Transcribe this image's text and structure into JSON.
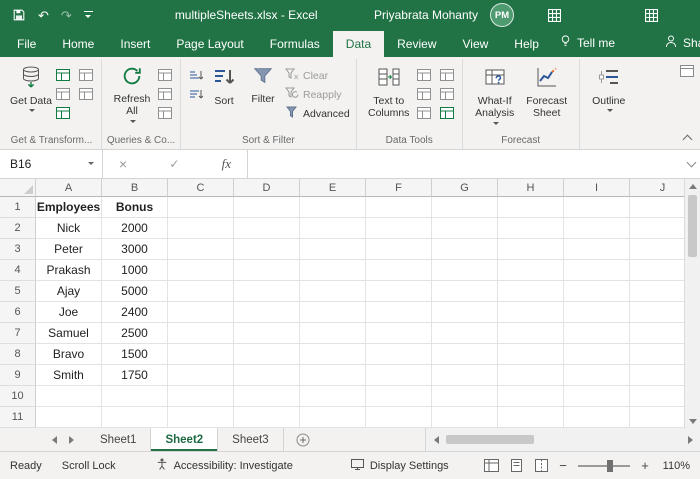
{
  "titlebar": {
    "title": "multipleSheets.xlsx - Excel",
    "user_name": "Priyabrata Mohanty",
    "avatar_initials": "PM"
  },
  "tabs": {
    "items": [
      "File",
      "Home",
      "Insert",
      "Page Layout",
      "Formulas",
      "Data",
      "Review",
      "View",
      "Help"
    ],
    "active": "Data",
    "tell_me": "Tell me",
    "share": "Share"
  },
  "ribbon": {
    "buttons": {
      "get_data": "Get Data",
      "refresh_all": "Refresh All",
      "sort": "Sort",
      "filter": "Filter",
      "clear": "Clear",
      "reapply": "Reapply",
      "advanced": "Advanced",
      "text_to_columns": "Text to Columns",
      "what_if": "What-If Analysis",
      "forecast_sheet": "Forecast Sheet",
      "outline": "Outline"
    },
    "groups": {
      "get_transform": "Get & Transform...",
      "queries": "Queries & Co...",
      "sort_filter": "Sort & Filter",
      "data_tools": "Data Tools",
      "forecast": "Forecast"
    }
  },
  "formula_bar": {
    "name_box": "B16",
    "formula": ""
  },
  "icons": {
    "undo": "↶",
    "redo": "↷",
    "cancel": "×",
    "enter": "✓",
    "fx": "fx",
    "zoom_out": "−",
    "zoom_in": "+"
  },
  "grid": {
    "columns": [
      "A",
      "B",
      "C",
      "D",
      "E",
      "F",
      "G",
      "H",
      "I",
      "J"
    ],
    "row_count": 11,
    "bold_cells": [
      "A1",
      "B1"
    ],
    "cells": {
      "A1": "Employees",
      "B1": "Bonus",
      "A2": "Nick",
      "B2": "2000",
      "A3": "Peter",
      "B3": "3000",
      "A4": "Prakash",
      "B4": "1000",
      "A5": "Ajay",
      "B5": "5000",
      "A6": "Joe",
      "B6": "2400",
      "A7": "Samuel",
      "B7": "2500",
      "A8": "Bravo",
      "B8": "1500",
      "A9": "Smith",
      "B9": "1750"
    }
  },
  "sheets": {
    "items": [
      "Sheet1",
      "Sheet2",
      "Sheet3"
    ],
    "active": "Sheet2"
  },
  "status_bar": {
    "ready": "Ready",
    "scroll_lock": "Scroll Lock",
    "accessibility": "Accessibility: Investigate",
    "display_settings": "Display Settings",
    "zoom_level": "110%"
  },
  "colors": {
    "excel_green": "#217346",
    "accent_green": "#107c41"
  }
}
